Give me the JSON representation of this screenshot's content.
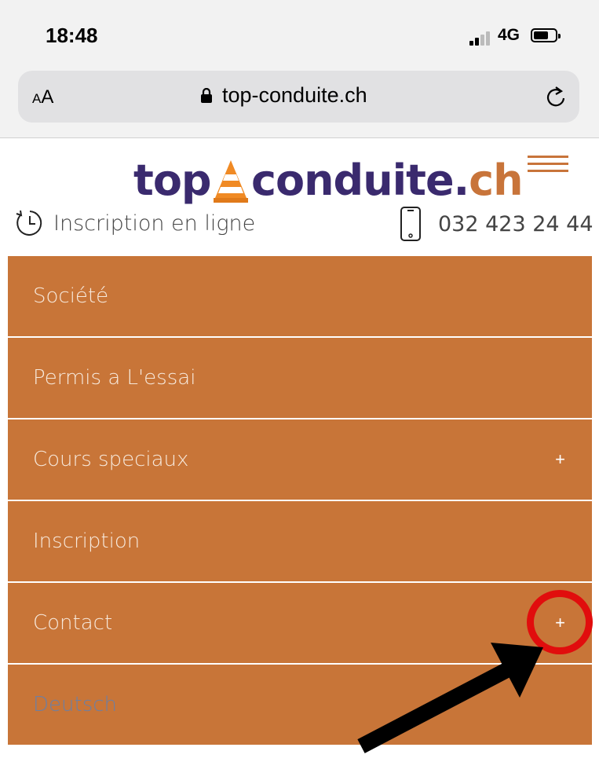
{
  "status": {
    "time": "18:48",
    "network": "4G",
    "icons": [
      "signal-icon",
      "battery-icon"
    ]
  },
  "browser": {
    "text_size_label_small": "A",
    "text_size_label_large": "A",
    "url": "top-conduite.ch",
    "icons": [
      "lock-icon",
      "reload-icon"
    ]
  },
  "header": {
    "logo_part1": "top",
    "logo_part2": "conduite.",
    "logo_part3": "ch",
    "inscription_label": "Inscription en ligne",
    "phone_label": "032 423 24 44",
    "icons": [
      "cone-icon",
      "hamburger-icon",
      "clock-icon",
      "phone-icon"
    ]
  },
  "menu": {
    "items": [
      {
        "label": "Société",
        "expandable": false
      },
      {
        "label": "Permis a L'essai",
        "expandable": false
      },
      {
        "label": "Cours speciaux",
        "expandable": true,
        "toggle": "+"
      },
      {
        "label": "Inscription",
        "expandable": false
      },
      {
        "label": "Contact",
        "expandable": true,
        "toggle": "+"
      },
      {
        "label": "Deutsch",
        "expandable": false
      }
    ]
  },
  "colors": {
    "menu_bg": "#c87538",
    "logo_purple": "#3a2a6e",
    "highlight_red": "#e10d0d"
  }
}
